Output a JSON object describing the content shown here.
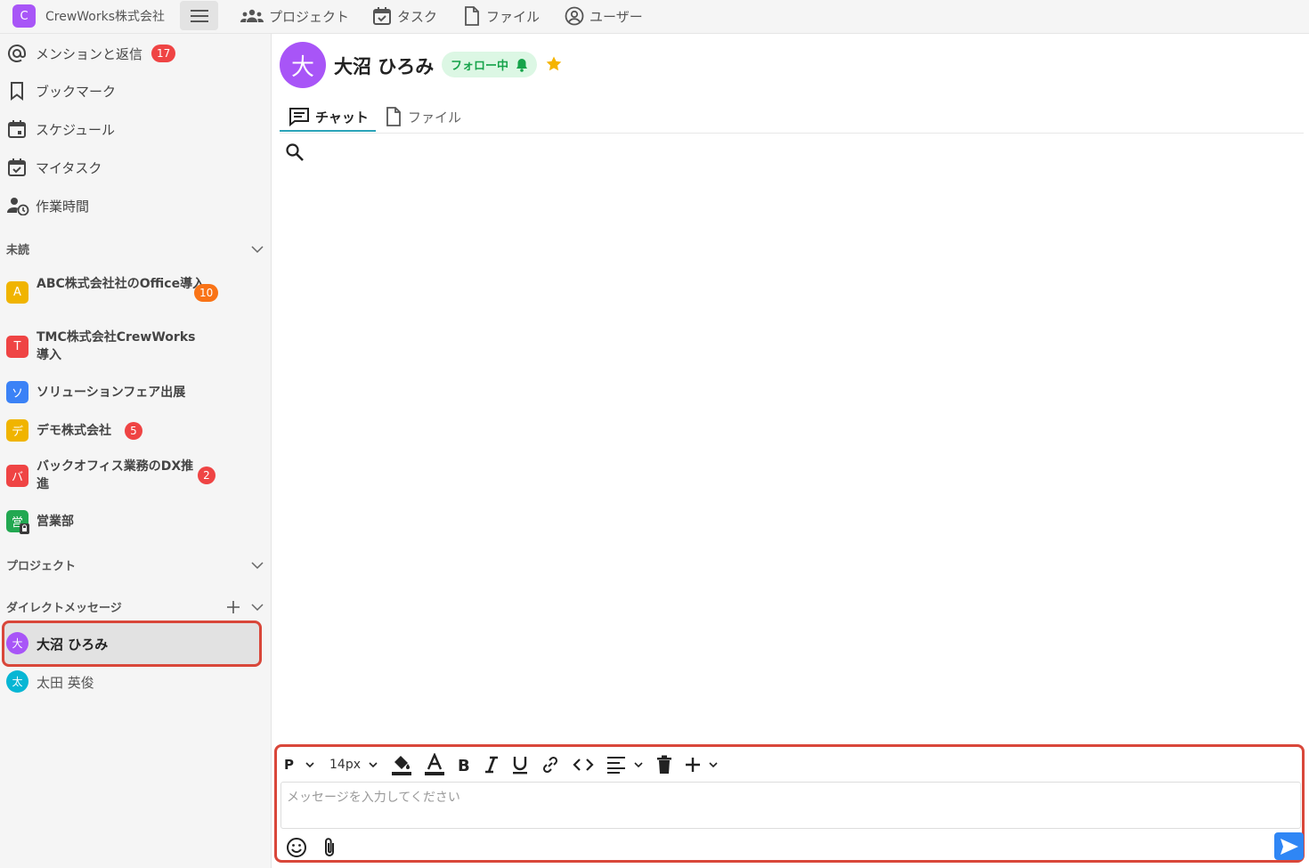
{
  "topbar": {
    "org_initial": "C",
    "org_name": "CrewWorks株式会社",
    "nav": [
      {
        "label": "プロジェクト",
        "icon": "team-icon"
      },
      {
        "label": "タスク",
        "icon": "calendar-check-icon"
      },
      {
        "label": "ファイル",
        "icon": "file-icon"
      },
      {
        "label": "ユーザー",
        "icon": "user-circle-icon"
      }
    ]
  },
  "sidebar": {
    "menu": [
      {
        "label": "メンションと返信",
        "icon": "at-icon",
        "count": "17"
      },
      {
        "label": "ブックマーク",
        "icon": "bookmark-icon"
      },
      {
        "label": "スケジュール",
        "icon": "calendar-icon"
      },
      {
        "label": "マイタスク",
        "icon": "calendar-check-icon"
      },
      {
        "label": "作業時間",
        "icon": "user-clock-icon"
      }
    ],
    "unread_title": "未読",
    "channels": [
      {
        "initial": "A",
        "label": "ABC株式会社社のOffice導入",
        "count": "10",
        "color": "#f0b400",
        "count_color": "#f97316"
      },
      {
        "initial": "T",
        "label": "TMC株式会社CrewWorks導入",
        "color": "#ef4444"
      },
      {
        "initial": "ソ",
        "label": "ソリューションフェア出展",
        "color": "#3b82f6"
      },
      {
        "initial": "デ",
        "label": "デモ株式会社",
        "count": "5",
        "color": "#f0b400",
        "count_color": "#ef4444"
      },
      {
        "initial": "バ",
        "label": "バックオフィス業務のDX推進",
        "count": "2",
        "color": "#ef4444",
        "count_color": "#ef4444"
      },
      {
        "initial": "営",
        "label": "営業部",
        "color": "#22a851"
      }
    ],
    "projects_title": "プロジェクト",
    "dm_title": "ダイレクトメッセージ",
    "dms": [
      {
        "initial": "大",
        "label": "大沼 ひろみ",
        "color": "#a855f7"
      },
      {
        "initial": "太",
        "label": "太田 英俊",
        "color": "#06b6d4"
      }
    ]
  },
  "header": {
    "initial": "大",
    "name": "大沼 ひろみ",
    "follow_label": "フォロー中"
  },
  "tabs": [
    {
      "label": "チャット",
      "active": true
    },
    {
      "label": "ファイル",
      "active": false
    }
  ],
  "composer": {
    "block_format": "P",
    "font_size": "14px",
    "placeholder": "メッセージを入力してください"
  },
  "colors": {
    "accent": "#2aa3b8",
    "highlight": "#d9473a",
    "send": "#2f86f5",
    "org": "#a855f7"
  }
}
